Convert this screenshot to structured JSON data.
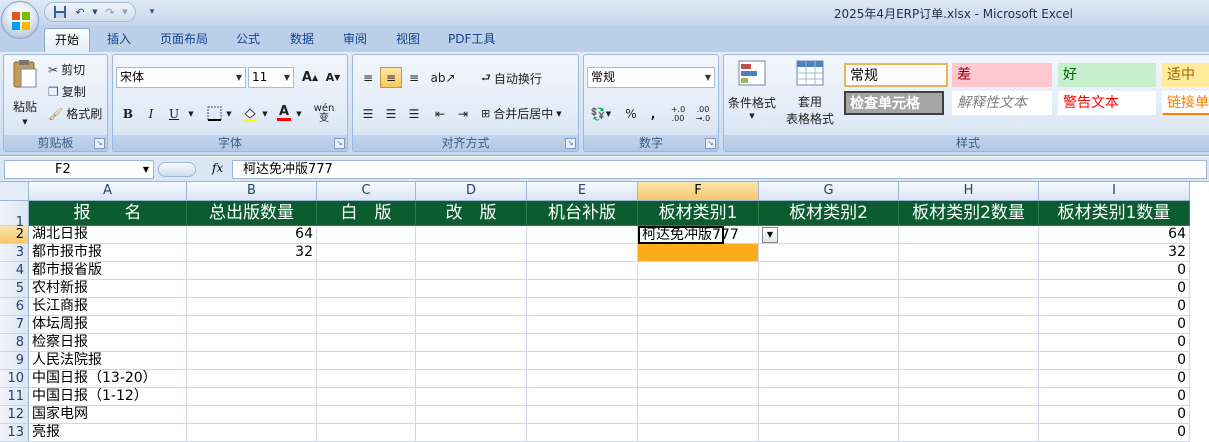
{
  "window": {
    "title": "2025年4月ERP订单.xlsx - Microsoft Excel"
  },
  "tabs": [
    "开始",
    "插入",
    "页面布局",
    "公式",
    "数据",
    "审阅",
    "视图",
    "PDF工具"
  ],
  "ribbon": {
    "clipboard": {
      "paste": "粘贴",
      "cut": "剪切",
      "copy": "复制",
      "format_painter": "格式刷",
      "label": "剪贴板"
    },
    "font": {
      "name": "宋体",
      "size": "11",
      "grow": "A",
      "shrink": "A",
      "bold": "B",
      "italic": "I",
      "underline": "U",
      "phonetic": "wén 变",
      "label": "字体"
    },
    "alignment": {
      "wrap": "自动换行",
      "merge": "合并后居中",
      "label": "对齐方式"
    },
    "number": {
      "format": "常规",
      "percent": "%",
      "comma": ",",
      "inc": "+.0 .00",
      "dec": ".00 →.0",
      "label": "数字"
    },
    "styles": {
      "conditional": "条件格式",
      "table_format_1": "套用",
      "table_format_2": "表格格式",
      "cells": [
        {
          "text": "常规",
          "style": "normal"
        },
        {
          "text": "差",
          "style": "bad"
        },
        {
          "text": "好",
          "style": "good"
        },
        {
          "text": "适中",
          "style": "neutral"
        },
        {
          "text": "检查单元格",
          "style": "check"
        },
        {
          "text": "解释性文本",
          "style": "explanatory"
        },
        {
          "text": "警告文本",
          "style": "warning"
        },
        {
          "text": "链接单",
          "style": "linked"
        }
      ],
      "label": "样式"
    }
  },
  "formula_bar": {
    "name_box": "F2",
    "fx": "fx",
    "content": "柯达免冲版777"
  },
  "sheet": {
    "columns": [
      "A",
      "B",
      "C",
      "D",
      "E",
      "F",
      "G",
      "H",
      "I"
    ],
    "selected_column": "F",
    "selected_row": "2",
    "header_row": [
      "报　　名",
      "总出版数量",
      "白　版",
      "改　版",
      "机台补版",
      "板材类别1",
      "板材类别2",
      "板材类别2数量",
      "板材类别1数量"
    ],
    "rows": [
      {
        "num": "2",
        "cells": [
          "湖北日报",
          "64",
          "",
          "",
          "",
          "柯达免冲版777",
          "",
          "",
          "64"
        ]
      },
      {
        "num": "3",
        "cells": [
          "都市报市报",
          "32",
          "",
          "",
          "",
          "",
          "",
          "",
          "32"
        ]
      },
      {
        "num": "4",
        "cells": [
          "都市报省版",
          "",
          "",
          "",
          "",
          "",
          "",
          "",
          "0"
        ]
      },
      {
        "num": "5",
        "cells": [
          "农村新报",
          "",
          "",
          "",
          "",
          "",
          "",
          "",
          "0"
        ]
      },
      {
        "num": "6",
        "cells": [
          "长江商报",
          "",
          "",
          "",
          "",
          "",
          "",
          "",
          "0"
        ]
      },
      {
        "num": "7",
        "cells": [
          "体坛周报",
          "",
          "",
          "",
          "",
          "",
          "",
          "",
          "0"
        ]
      },
      {
        "num": "8",
        "cells": [
          "检察日报",
          "",
          "",
          "",
          "",
          "",
          "",
          "",
          "0"
        ]
      },
      {
        "num": "9",
        "cells": [
          "人民法院报",
          "",
          "",
          "",
          "",
          "",
          "",
          "",
          "0"
        ]
      },
      {
        "num": "10",
        "cells": [
          "中国日报（13-20）",
          "",
          "",
          "",
          "",
          "",
          "",
          "",
          "0"
        ]
      },
      {
        "num": "11",
        "cells": [
          "中国日报（1-12）",
          "",
          "",
          "",
          "",
          "",
          "",
          "",
          "0"
        ]
      },
      {
        "num": "12",
        "cells": [
          "国家电网",
          "",
          "",
          "",
          "",
          "",
          "",
          "",
          "0"
        ]
      },
      {
        "num": "13",
        "cells": [
          "亮报",
          "",
          "",
          "",
          "",
          "",
          "",
          "",
          "0"
        ]
      }
    ],
    "highlight_color": "#fcab1b",
    "header_color": "#0b5c30"
  }
}
